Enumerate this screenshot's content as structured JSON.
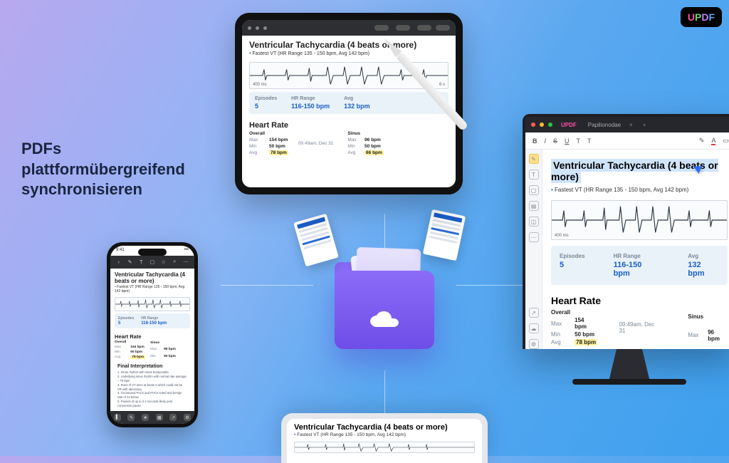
{
  "logo": {
    "u": "U",
    "p": "P",
    "d": "D",
    "f": "F"
  },
  "headline": "PDFs\nplattformübergreifend\nsynchronisieren",
  "doc": {
    "title": "Ventricular Tachycardia (4 beats or more)",
    "subtitle": "Fastest VT (HR Range 135 - 150 bpm, Avg 142 bpm)",
    "ecg_left": "400 ms",
    "ecg_right": "6 s",
    "stats": {
      "episodes_lbl": "Episodes",
      "episodes_val": "5",
      "range_lbl": "HR Range",
      "range_val": "116-150 bpm",
      "avg_lbl": "Avg",
      "avg_val": "132 bpm"
    },
    "hr_header": "Heart Rate",
    "hr": {
      "overall": "Overall",
      "max_lbl": "Max",
      "max_val": "154 bpm",
      "min_lbl": "Min",
      "min_val": "50 bpm",
      "avg_lbl": "Avg",
      "avg_val": "78 bpm",
      "time1": "09:49am, Dec 31",
      "sinus": "Sinus",
      "s_max_lbl": "Max",
      "s_max_val": "96 bpm",
      "s_min_lbl": "Min",
      "s_min_val": "50 bpm",
      "s_avg_lbl": "Avg",
      "s_avg_val": "66 bpm"
    },
    "final_header": "Final Interpretation",
    "final_body": "1. Sinus rhythm with sinus bradycardia\n2. Underlying sinus rhythm with normal rate average – 78 bpm\n3. Runs of VT seen at beats 4 which could not be VR with aberrancy\n4. Occasional PACs and PVCs noted and benign rate of 23 below\n5. Pauses of up to 2.4 seconds likely post conversion pause"
  },
  "monitor": {
    "tab": "Papilionodae",
    "tool_b": "B",
    "tool_i": "I",
    "tool_s": "S",
    "tool_u": "U",
    "tool_t": "T",
    "tool_tt": "T",
    "tool_a": "A"
  },
  "phone": {
    "time": "9:41"
  }
}
